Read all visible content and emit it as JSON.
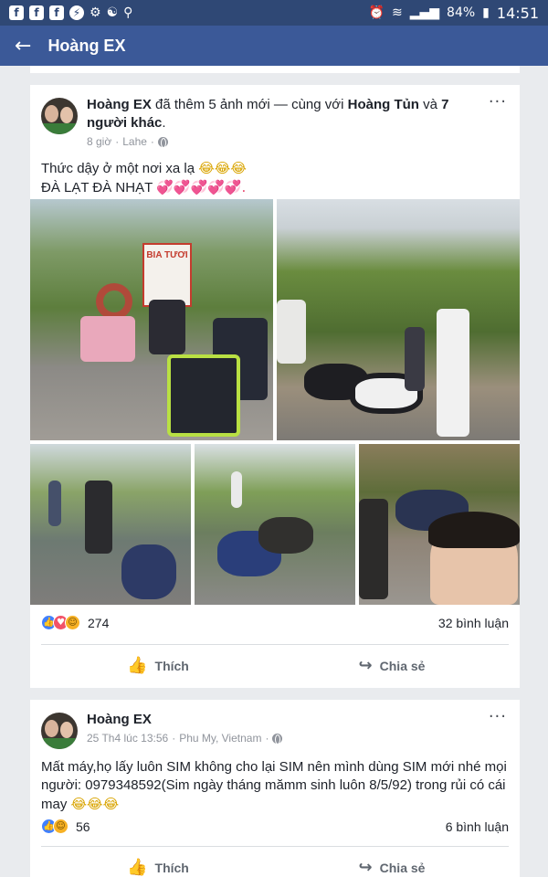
{
  "status_bar": {
    "left_icons": [
      "facebook-icon",
      "facebook-icon",
      "facebook-icon",
      "messenger-icon",
      "settings-app-icon",
      "yin-yang-icon",
      "location-icon"
    ],
    "battery": "84%",
    "time": "14:51"
  },
  "app_bar": {
    "title": "Hoàng EX"
  },
  "post1": {
    "author": "Hoàng EX",
    "header_mid": " đã thêm 5 ảnh mới — cùng với ",
    "tagged": "Hoàng Tủn",
    "header_and": " và ",
    "others": "7 người khác",
    "header_end": ".",
    "time": "8 giờ",
    "location": "Lahe",
    "text_line1": "Thức dậy ở một nơi xa lạ",
    "text_line1_emoji": "😂😂😂",
    "text_line2": "ĐÀ LẠT ĐÀ NHẠT",
    "text_line2_emoji": "💞💞💞💞💞.",
    "sign_text": "BIA TƯƠI",
    "reactions": [
      "like",
      "love",
      "haha"
    ],
    "reaction_count": "274",
    "comments": "32 bình luận",
    "like_label": "Thích",
    "share_label": "Chia sẻ"
  },
  "post2": {
    "author": "Hoàng EX",
    "time": "25 Th4 lúc 13:56",
    "location": "Phu My, Vietnam",
    "text": "Mất máy,họ lấy luôn SIM không cho lại SIM nên mình dùng SIM mới nhé mọi người: 0979348592(Sim ngày tháng mămm sinh luôn 8/5/92) trong rủi có cái may",
    "text_emoji": "😂😂😂",
    "reactions": [
      "like",
      "haha"
    ],
    "reaction_count": "56",
    "comments": "6 bình luận",
    "like_label": "Thích",
    "share_label": "Chia sẻ"
  }
}
